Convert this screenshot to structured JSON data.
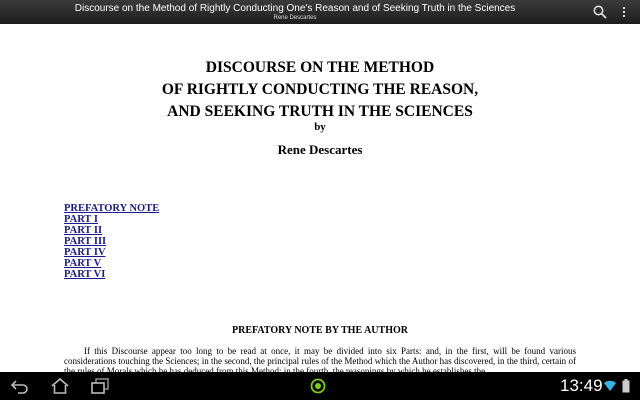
{
  "top_bar": {
    "title": "Discourse on the Method of Rightly Conducting One's Reason and of Seeking Truth in the Sciences",
    "author": "Rene Descartes",
    "icons": {
      "search": "search-icon",
      "menu": "overflow-menu-icon"
    }
  },
  "document": {
    "heading_lines": [
      "DISCOURSE ON THE METHOD",
      "OF RIGHTLY CONDUCTING THE REASON,",
      "AND SEEKING TRUTH IN THE SCIENCES"
    ],
    "by": "by",
    "author": "Rene Descartes",
    "toc": [
      "PREFATORY NOTE",
      "PART I",
      "PART II",
      "PART III",
      "PART IV",
      "PART V",
      "PART VI"
    ],
    "section_title": "PREFATORY NOTE BY THE AUTHOR",
    "paragraph": "If this Discourse appear too long to be read at once, it may be divided into six Parts: and, in the first, will be found various considerations touching the Sciences; in the second, the principal rules of the Method which the Author has discovered, in the third, certain of the rules of Morals which he has deduced from this Method; in the fourth, the reasonings by which he establishes the"
  },
  "nav_bar": {
    "icons": {
      "back": "back-icon",
      "home": "home-icon",
      "recent": "recent-apps-icon",
      "app": "app-indicator-icon",
      "wifi": "wifi-icon",
      "battery": "battery-icon"
    },
    "time": "13:49"
  },
  "colors": {
    "link": "#1a1a8c",
    "accent_green": "#7ccd1c",
    "status_blue": "#33b5e5"
  }
}
